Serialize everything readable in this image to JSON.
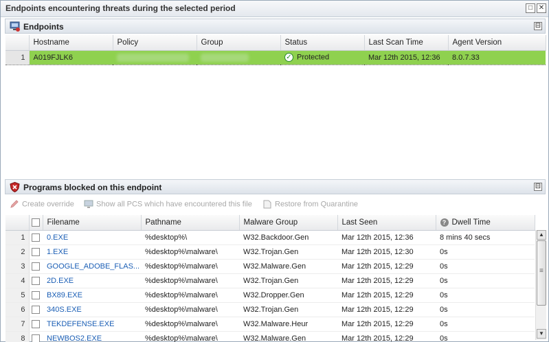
{
  "window": {
    "title": "Endpoints encountering threats during the selected period",
    "restore_glyph": "□",
    "close_glyph": "✕"
  },
  "endpoints_panel": {
    "title": "Endpoints",
    "icon": "computer-icon",
    "collapse_glyph": "⊟",
    "columns": [
      "Hostname",
      "Policy",
      "Group",
      "Status",
      "Last Scan Time",
      "Agent Version"
    ],
    "rows": [
      {
        "num": "1",
        "hostname": "A019FJLK6",
        "status": "Protected",
        "status_icon": "check-circle-icon",
        "last_scan": "Mar 12th 2015, 12:36",
        "agent_version": "8.0.7.33"
      }
    ],
    "selected_color": "#8fd14f"
  },
  "programs_panel": {
    "title": "Programs blocked on this endpoint",
    "icon": "shield-x-icon",
    "collapse_glyph": "⊟",
    "toolbar": {
      "create_override": "Create override",
      "show_all_pcs": "Show all PCS which have encountered this file",
      "restore_quarantine": "Restore from Quarantine"
    },
    "columns": [
      "Filename",
      "Pathname",
      "Malware Group",
      "Last Seen",
      "Dwell Time"
    ],
    "rows": [
      {
        "num": "1",
        "filename": "0.EXE",
        "pathname": "%desktop%\\",
        "malware_group": "W32.Backdoor.Gen",
        "last_seen": "Mar 12th 2015, 12:36",
        "dwell": "8 mins 40 secs"
      },
      {
        "num": "2",
        "filename": "1.EXE",
        "pathname": "%desktop%\\malware\\",
        "malware_group": "W32.Trojan.Gen",
        "last_seen": "Mar 12th 2015, 12:30",
        "dwell": "0s"
      },
      {
        "num": "3",
        "filename": "GOOGLE_ADOBE_FLAS...",
        "pathname": "%desktop%\\malware\\",
        "malware_group": "W32.Malware.Gen",
        "last_seen": "Mar 12th 2015, 12:29",
        "dwell": "0s"
      },
      {
        "num": "4",
        "filename": "2D.EXE",
        "pathname": "%desktop%\\malware\\",
        "malware_group": "W32.Trojan.Gen",
        "last_seen": "Mar 12th 2015, 12:29",
        "dwell": "0s"
      },
      {
        "num": "5",
        "filename": "BX89.EXE",
        "pathname": "%desktop%\\malware\\",
        "malware_group": "W32.Dropper.Gen",
        "last_seen": "Mar 12th 2015, 12:29",
        "dwell": "0s"
      },
      {
        "num": "6",
        "filename": "340S.EXE",
        "pathname": "%desktop%\\malware\\",
        "malware_group": "W32.Trojan.Gen",
        "last_seen": "Mar 12th 2015, 12:29",
        "dwell": "0s"
      },
      {
        "num": "7",
        "filename": "TEKDEFENSE.EXE",
        "pathname": "%desktop%\\malware\\",
        "malware_group": "W32.Malware.Heur",
        "last_seen": "Mar 12th 2015, 12:29",
        "dwell": "0s"
      },
      {
        "num": "8",
        "filename": "NEWBOS2.EXE",
        "pathname": "%desktop%\\malware\\",
        "malware_group": "W32.Malware.Gen",
        "last_seen": "Mar 12th 2015, 12:29",
        "dwell": "0s"
      }
    ]
  }
}
